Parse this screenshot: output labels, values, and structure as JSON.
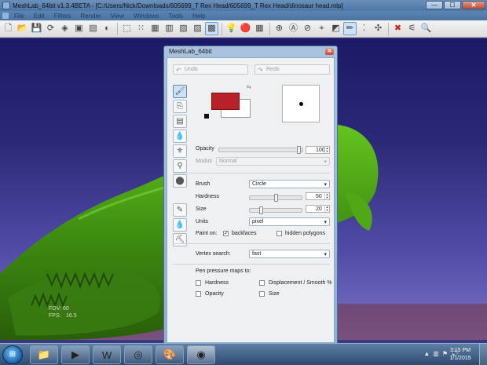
{
  "window": {
    "title": "MeshLab_64bit v1.3.4BETA - [C:/Users/Nick/Downloads/605699_T Rex Head/605699_T Rex Head/dinosaur head.mlp]",
    "minimize": "—",
    "maximize": "☐",
    "close": "✕"
  },
  "menu": [
    "File",
    "Edit",
    "Filters",
    "Render",
    "View",
    "Windows",
    "Tools",
    "Help"
  ],
  "viewport": {
    "fov_label": "FOV: 60",
    "fps_label": "FPS:",
    "fps_value": "16.5"
  },
  "dialog": {
    "title": "MeshLab_64bit",
    "close": "✕",
    "undo": "Undo",
    "redo": "Redo",
    "colors": {
      "foreground": "#b82226",
      "background": "#ffffff"
    },
    "opacity": {
      "label": "Opacity",
      "value": "100",
      "fraction": 0.98
    },
    "modus": {
      "label": "Modus",
      "value": "Normal"
    },
    "brush": {
      "label": "Brush",
      "value": "Circle"
    },
    "hardness": {
      "label": "Hardness",
      "value": "50",
      "fraction": 0.5
    },
    "size": {
      "label": "Size",
      "value": "20",
      "fraction": 0.2
    },
    "units": {
      "label": "Units",
      "value": "pixel"
    },
    "paint_on": {
      "label": "Paint on:",
      "backfaces": "backfaces",
      "backfaces_checked": true,
      "hidden": "hidden polygons",
      "hidden_checked": false
    },
    "vertex_search": {
      "label": "Vertex search:",
      "value": "fast"
    },
    "pen_pressure": {
      "label": "Pen pressure maps to:",
      "hardness": "Hardness",
      "displacement": "Displacement / Smooth %",
      "opacity": "Opacity",
      "size": "Size"
    }
  },
  "taskbar": {
    "time": "3:15 PM",
    "date": "1/1/2015"
  }
}
